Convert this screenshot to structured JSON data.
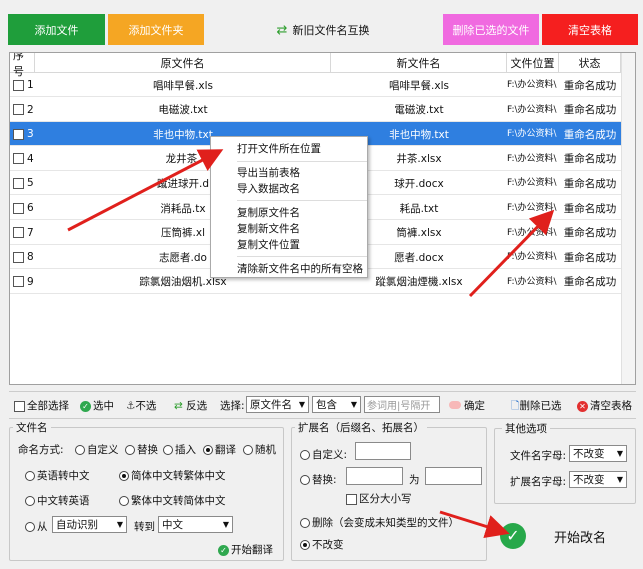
{
  "toolbar": {
    "add_file": "添加文件",
    "add_folder": "添加文件夹",
    "swap": "新旧文件名互换",
    "delete_selected": "删除已选的文件",
    "clear_table": "清空表格"
  },
  "table": {
    "headers": [
      "序号",
      "原文件名",
      "新文件名",
      "文件位置",
      "状态"
    ],
    "rows": [
      {
        "no": "1",
        "old": "唱啡早餐.xls",
        "new": "唱啡早餐.xls",
        "loc": "F:\\办公资料\\",
        "status": "重命名成功"
      },
      {
        "no": "2",
        "old": "电磁波.txt",
        "new": "電磁波.txt",
        "loc": "F:\\办公资料\\",
        "status": "重命名成功"
      },
      {
        "no": "3",
        "old": "非也中物.txt",
        "new": "非也中物.txt",
        "loc": "F:\\办公资料\\",
        "status": "重命名成功"
      },
      {
        "no": "4",
        "old": "龙井茶.",
        "new": "井茶.xlsx",
        "loc": "F:\\办公资料\\",
        "status": "重命名成功"
      },
      {
        "no": "5",
        "old": "蹴进球开.d",
        "new": "球开.docx",
        "loc": "F:\\办公资料\\",
        "status": "重命名成功"
      },
      {
        "no": "6",
        "old": "消耗品.tx",
        "new": "耗品.txt",
        "loc": "F:\\办公资料\\",
        "status": "重命名成功"
      },
      {
        "no": "7",
        "old": "压筒裤.xl",
        "new": "筒褲.xlsx",
        "loc": "F:\\办公资料\\",
        "status": "重命名成功"
      },
      {
        "no": "8",
        "old": "志愿者.do",
        "new": "愿者.docx",
        "loc": "F:\\办公资料\\",
        "status": "重命名成功"
      },
      {
        "no": "9",
        "old": "踪氯烟油烟机.xlsx",
        "new": "蹤氯烟油煙機.xlsx",
        "loc": "F:\\办公资料\\",
        "status": "重命名成功"
      }
    ]
  },
  "context_menu": {
    "open_location": "打开文件所在位置",
    "export_table": "导出当前表格",
    "import_names": "导入数据改名",
    "copy_original": "复制原文件名",
    "copy_new": "复制新文件名",
    "copy_location": "复制文件位置",
    "clear_spaces": "清除新文件名中的所有空格"
  },
  "bottombar": {
    "select_all": "全部选择",
    "select": "选中",
    "deselect": "不选",
    "invert": "反选",
    "choose_label": "选择:",
    "field_value": "原文件名",
    "match_value": "包含",
    "param_placeholder": "参词用|号隔开",
    "confirm": "确定",
    "delete_selected": "删除已选",
    "clear_table": "清空表格"
  },
  "filename_group": {
    "title": "文件名",
    "mode_label": "命名方式:",
    "modes": [
      "自定义",
      "替换",
      "插入",
      "翻译",
      "随机"
    ],
    "opt_en_zh": "英语转中文",
    "opt_s2t": "简体中文转繁体中文",
    "opt_zh_en": "中文转英语",
    "opt_t2s": "繁体中文转简体中文",
    "from_label": "从",
    "from_value": "自动识别",
    "to_label": "转到",
    "to_value": "中文",
    "start_translate": "开始翻译"
  },
  "ext_group": {
    "title": "扩展名（后缀名、拓展名）",
    "custom": "自定义:",
    "replace": "替换:",
    "as": "为",
    "case": "区分大小写",
    "delete": "删除（会变成未知类型的文件）",
    "no_change": "不改变"
  },
  "other_group": {
    "title": "其他选项",
    "file_case_label": "文件名字母:",
    "file_case_value": "不改变",
    "ext_case_label": "扩展名字母:",
    "ext_case_value": "不改变"
  },
  "start_button": "开始改名",
  "colors": {
    "green": "#1f9e3b",
    "orange": "#f5a623",
    "pink": "#f06ae0",
    "red": "#f51f1f",
    "selection": "#2f7fe0",
    "arrow": "#e0201c"
  }
}
